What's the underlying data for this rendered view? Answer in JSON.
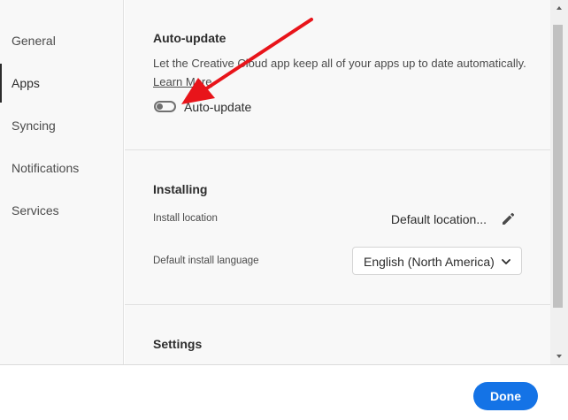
{
  "sidebar": {
    "items": [
      {
        "label": "General",
        "active": false
      },
      {
        "label": "Apps",
        "active": true
      },
      {
        "label": "Syncing",
        "active": false
      },
      {
        "label": "Notifications",
        "active": false
      },
      {
        "label": "Services",
        "active": false
      }
    ]
  },
  "auto_update": {
    "title": "Auto-update",
    "description": "Let the Creative Cloud app keep all of your apps up to date automatically.",
    "learn_more": "Learn More",
    "toggle_label": "Auto-update",
    "toggle_on": false
  },
  "installing": {
    "title": "Installing",
    "location_label": "Install location",
    "location_value": "Default location...",
    "language_label": "Default install language",
    "language_value": "English (North America)"
  },
  "settings": {
    "title": "Settings"
  },
  "footer": {
    "done_label": "Done"
  },
  "colors": {
    "accent": "#1473e6",
    "annotation_arrow": "#e8141a",
    "panel_bg": "#f8f8f8"
  }
}
